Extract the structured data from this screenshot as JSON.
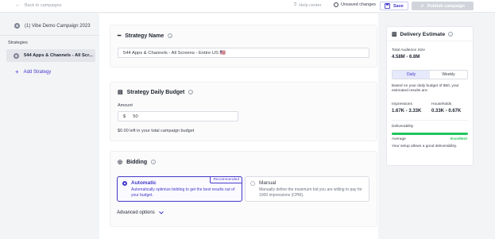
{
  "header": {
    "back_label": "Back to campaigns",
    "help_label": "Help center",
    "unsaved_label": "Unsaved changes",
    "save_label": "Save",
    "publish_label": "Publish campaign"
  },
  "sidebar": {
    "campaign_name": "(1) Vibe Demo Campaign 2023",
    "strategies_label": "Strategies",
    "strategy_item": "544 Apps & Channels - All Scr...",
    "add_strategy_label": "Add Strategy"
  },
  "strategy_name": {
    "title": "Strategy Name",
    "value": "544 Apps & Channels - All Screens - Entire US 🇺🇸"
  },
  "budget": {
    "title": "Strategy Daily Budget",
    "amount_label": "Amount",
    "currency": "$",
    "amount_value": "50",
    "left_text": "$0.00 left in your total campaign budget"
  },
  "bidding": {
    "title": "Bidding",
    "automatic_title": "Automatic",
    "automatic_desc": "Automatically optimize bidding to get the best results out of your budget.",
    "recommended_badge": "Recommended",
    "manual_title": "Manual",
    "manual_desc": "Manually define the maximum bid you are willing to pay for 1000 impressions (CPM).",
    "advanced_label": "Advanced options"
  },
  "estimate": {
    "title": "Delivery Estimate",
    "audience_label": "Total Audience Size",
    "audience_value": "4.58M - 6.8M",
    "toggle": [
      "Daily",
      "Weekly"
    ],
    "toggle_active": "Daily",
    "note": "Based on your daily budget of $50, your estimated results are:",
    "impressions_label": "Impressions",
    "impressions_value": "1.67K - 3.33K",
    "households_label": "Households",
    "households_value": "0.33K - 0.67K",
    "deliverability_label": "Deliverability",
    "level_label": "Average",
    "level_value": "Excellent",
    "deliverability_fraction": 1.0,
    "setup_note": "Your setup allows a good deliverability."
  },
  "colors": {
    "accent": "#4338ca",
    "success": "#22c55e"
  }
}
